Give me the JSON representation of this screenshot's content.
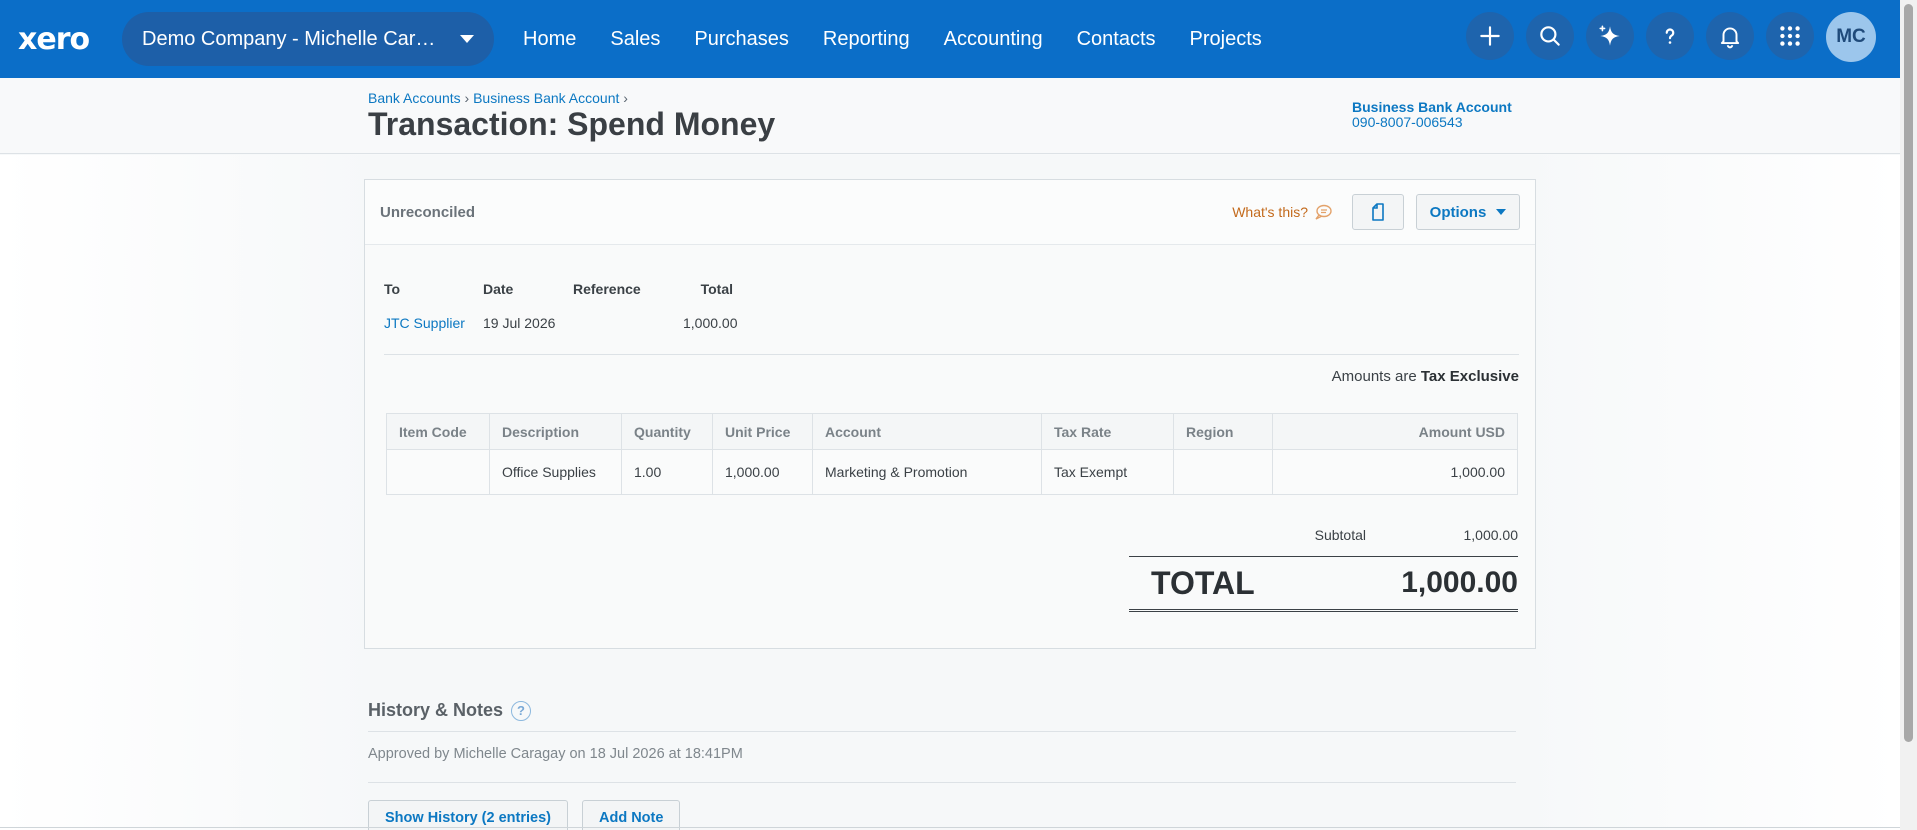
{
  "nav": {
    "logo": "xero",
    "org_name": "Demo Company - Michelle Caragay",
    "links": [
      "Home",
      "Sales",
      "Purchases",
      "Reporting",
      "Accounting",
      "Contacts",
      "Projects"
    ],
    "icons": [
      "plus-icon",
      "search-icon",
      "sparkle-icon",
      "help-icon",
      "bell-icon",
      "apps-grid-icon"
    ],
    "avatar_initials": "MC",
    "color": "#0b6ec8"
  },
  "header": {
    "breadcrumb": [
      "Bank Accounts",
      "Business Bank Account"
    ],
    "title": "Transaction: Spend Money",
    "bank_name": "Business Bank Account",
    "bank_number": "090-8007-006543"
  },
  "card": {
    "status": "Unreconciled",
    "whats_this": "What's this?",
    "options_label": "Options",
    "summary_headers": [
      "To",
      "Date",
      "Reference",
      "Total"
    ],
    "to": "JTC Supplier",
    "date": "19 Jul 2026",
    "reference": "",
    "total": "1,000.00",
    "amounts_are_prefix": "Amounts are",
    "amounts_are_value": "Tax Exclusive",
    "line_headers": [
      "Item Code",
      "Description",
      "Quantity",
      "Unit Price",
      "Account",
      "Tax Rate",
      "Region",
      "Amount USD"
    ],
    "lines": [
      {
        "item_code": "",
        "description": "Office Supplies",
        "quantity": "1.00",
        "unit_price": "1,000.00",
        "account": "Marketing & Promotion",
        "tax_rate": "Tax Exempt",
        "region": "",
        "amount": "1,000.00"
      }
    ],
    "subtotal_label": "Subtotal",
    "subtotal_value": "1,000.00",
    "total_label": "TOTAL",
    "total_value": "1,000.00"
  },
  "history": {
    "title": "History & Notes",
    "entry": "Approved by Michelle Caragay on 18 Jul 2026 at 18:41PM",
    "show_history_label": "Show History (2 entries)",
    "add_note_label": "Add Note"
  }
}
